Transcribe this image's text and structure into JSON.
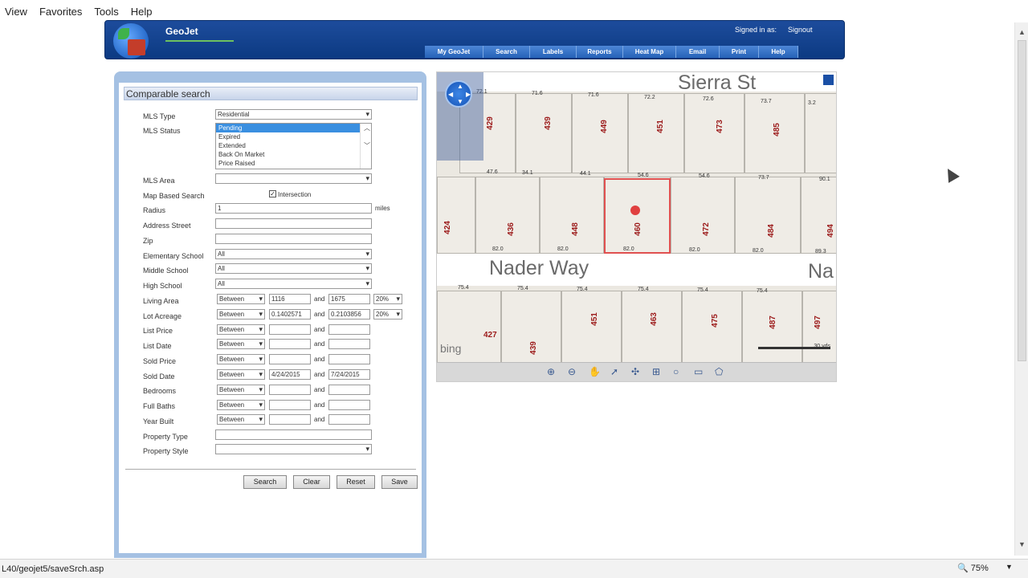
{
  "menubar": {
    "items": [
      "View",
      "Favorites",
      "Tools",
      "Help"
    ]
  },
  "header": {
    "brand": "GeoJet",
    "signed_in_label": "Signed in as:",
    "signout": "Signout",
    "nav": [
      "My GeoJet",
      "Search",
      "Labels",
      "Reports",
      "Heat Map",
      "Email",
      "Print",
      "Help"
    ]
  },
  "panel": {
    "title": "Comparable search",
    "labels": {
      "mls_type": "MLS Type",
      "mls_status": "MLS Status",
      "mls_area": "MLS Area",
      "map_based": "Map Based Search",
      "radius": "Radius",
      "address": "Address Street",
      "zip": "Zip",
      "elementary": "Elementary School",
      "middle": "Middle School",
      "high": "High School",
      "living_area": "Living Area",
      "lot_acreage": "Lot Acreage",
      "list_price": "List Price",
      "list_date": "List Date",
      "sold_price": "Sold Price",
      "sold_date": "Sold Date",
      "bedrooms": "Bedrooms",
      "full_baths": "Full Baths",
      "year_built": "Year Built",
      "property_type": "Property Type",
      "property_style": "Property Style"
    },
    "mls_type_value": "Residential",
    "mls_status_options": [
      "Pending",
      "Expired",
      "Extended",
      "Back On Market",
      "Price Raised"
    ],
    "intersection_label": "Intersection",
    "radius_value": "1",
    "radius_unit": "miles",
    "school_value": "All",
    "between": "Between",
    "and": "and",
    "living_area": {
      "min": "1116",
      "max": "1675",
      "pct": "20%"
    },
    "lot_acreage": {
      "min": "0.1402571",
      "max": "0.2103856",
      "pct": "20%"
    },
    "sold_date": {
      "min": "4/24/2015",
      "max": "7/24/2015"
    },
    "buttons": {
      "search": "Search",
      "clear": "Clear",
      "reset": "Reset",
      "save": "Save"
    }
  },
  "map": {
    "streets": {
      "top": "Sierra St",
      "middle": "Nader Way",
      "right": "Na"
    },
    "parcels_top": [
      "429",
      "439",
      "449",
      "451",
      "473",
      "485"
    ],
    "parcels_mid": [
      "424",
      "436",
      "448",
      "460",
      "472",
      "484",
      "494"
    ],
    "parcels_bot": [
      "427",
      "439",
      "451",
      "463",
      "475",
      "487",
      "497"
    ],
    "dims_top": [
      "72.1",
      "71.6",
      "71.6",
      "72.2",
      "72.6",
      "73.7",
      "3.2"
    ],
    "dims_row2": [
      "47.6",
      "34.1",
      "44.1",
      "54.6",
      "54.6",
      "73.7",
      "90.1"
    ],
    "dims_row3": [
      "82.0",
      "82.0",
      "82.0",
      "82.0",
      "82.0",
      "89.3"
    ],
    "dims_row4": [
      "75.4",
      "75.4",
      "75.4",
      "75.4",
      "75.4",
      "75.4"
    ],
    "bing": "bing",
    "scale": "30 yds"
  },
  "status": {
    "url": "L40/geojet5/saveSrch.asp",
    "zoom": "75%"
  }
}
